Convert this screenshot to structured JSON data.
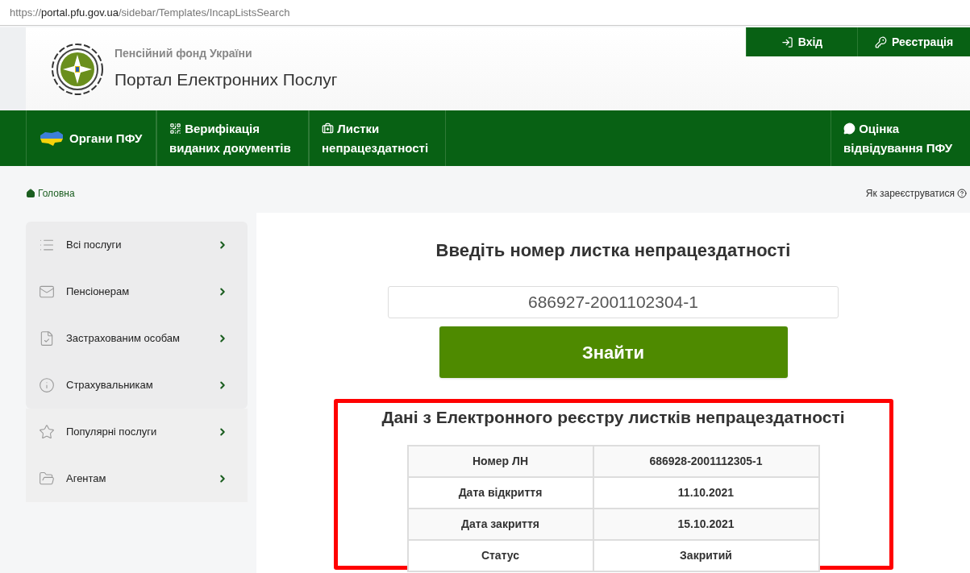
{
  "address_bar": {
    "host": "portal.pfu.gov.ua",
    "path": "/sidebar/Templates/IncapListsSearch",
    "scheme": "https://"
  },
  "header": {
    "org": "Пенсійний фонд України",
    "title": "Портал Електронних Послуг"
  },
  "account_buttons": [
    {
      "label": "Вхід"
    },
    {
      "label": "Реєстрація"
    }
  ],
  "nav": {
    "items": [
      {
        "label": "Органи ПФУ"
      },
      {
        "label": "Верифікація виданих документів"
      },
      {
        "label": "Листки непрацездатності"
      }
    ],
    "right_item": {
      "label": "Оцінка відвідування ПФУ"
    }
  },
  "breadcrumb": {
    "label": "Головна"
  },
  "help_link": {
    "label": "Як зареєструватися"
  },
  "sidebar": {
    "groups": [
      {
        "items": [
          {
            "label": "Всі послуги"
          },
          {
            "label": "Пенсіонерам"
          },
          {
            "label": "Застрахованим особам"
          },
          {
            "label": "Страхувальникам"
          }
        ]
      },
      {
        "items": [
          {
            "label": "Популярні послуги"
          },
          {
            "label": "Агентам"
          }
        ]
      }
    ]
  },
  "search": {
    "heading": "Введіть номер листка непрацездатності",
    "value": "686927-2001102304-1",
    "button": "Знайти"
  },
  "result": {
    "highlighted": true,
    "heading": "Дані з Електронного реєстру листків непрацездатності",
    "rows": [
      {
        "label": "Номер ЛН",
        "value": "686928-2001112305-1"
      },
      {
        "label": "Дата відкриття",
        "value": "11.10.2021"
      },
      {
        "label": "Дата закриття",
        "value": "15.10.2021"
      },
      {
        "label": "Статус",
        "value": "Закритий"
      }
    ]
  }
}
